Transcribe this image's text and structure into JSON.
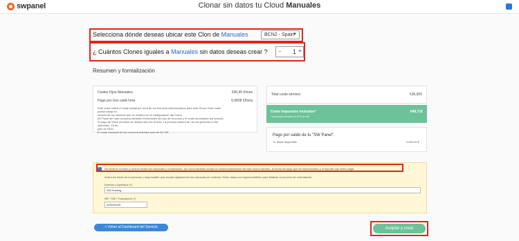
{
  "app": {
    "logo_text": "swpanel",
    "title_prefix": "Clonar sin datos tu Cloud",
    "title_emphasis": "Manuales"
  },
  "location_question": {
    "text": "Selecciona dónde deseas ubicar este Clon de",
    "accent": "Manuales",
    "selected": "BCN2 - Spain"
  },
  "clones_question": {
    "text_before": "¿ Cuántos Clones iguales a",
    "accent": "Manuales",
    "text_after": "sin datos deseas crear ?",
    "minus": "-",
    "value": "1",
    "plus": "+"
  },
  "summary": {
    "title": "Resumen y formalización",
    "fixed_costs_label": "Costes Fijos Manuales",
    "fixed_costs_value": "536,95 €/mes",
    "hourly_label": "Pago por Uso cada hora",
    "hourly_value": "0,0828 €/hora",
    "notes": [
      "Este coste indica el coste actual por hora de los recursos seleccionados para este Cloud. Este coste puede variar en",
      "función de los cambios que se realicen en la configuración del Cloud.",
      "(El Panel sin más recursos) también información del uso de recursos y el coste acumulado del periodo.",
      "El pago de estos recursos se realiza una vez al mes. La próxima factura de uso se generará el día miércoles, 15 de",
      "julio de 2020.",
      "El coste mensual de los recursos actuales será de 59,73€"
    ],
    "total_label": "Total coste servicio",
    "total_value": "536,95€",
    "taxes_label": "Coste impuestos incluidos*",
    "taxes_value": "649,71€",
    "taxes_note": "* Impuestos incluidos el 21% de IVA",
    "balance_title": "Pago por saldo de tu \"SW Panel\".",
    "balance_label": "Tu Saldo disponible",
    "balance_value": "2.000,00 €"
  },
  "contract": {
    "accept_prefix": "He leído el",
    "link_contract": "contrato",
    "accept_and": "y",
    "link_accept": "acepto",
    "accept_suffix": "todas sus cláusulas y condiciones, así como también acepto la creación/activación de este nuevo servicio, la forma de pago que he seleccionado y el importe que debo pagar.",
    "info_text": "Indica los datos de la persona o responsable que acepta digitalmente las cláusulas de contrato. Estos datos son imprescindibles para finalizar el proceso de contratación.",
    "name_label": "Nombre y Apellidos (*)",
    "name_value": "SW Hosting",
    "nif_label": "NIF / NIE / Passaporte (*)",
    "nif_value": "40404040D"
  },
  "actions": {
    "back_label": "< Volver al Dashboard del Servicio",
    "accept_label": "Aceptar y crear"
  },
  "colors": {
    "accent": "#2b6cc4",
    "highlight": "#e2231a",
    "green": "#6cc29a",
    "blue_button": "#3b88d8",
    "brand_orange": "#f26522"
  }
}
